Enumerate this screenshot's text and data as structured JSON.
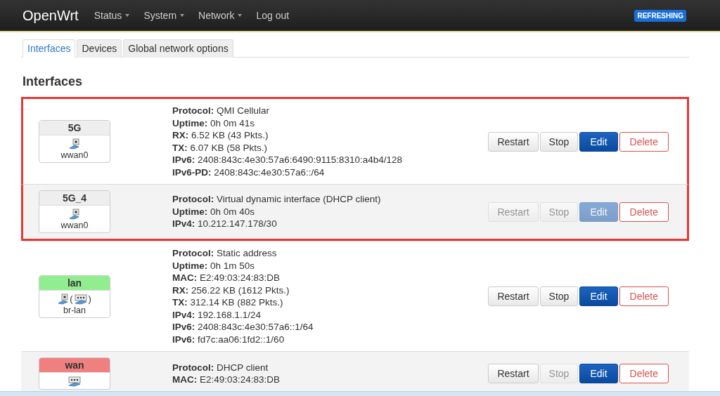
{
  "navbar": {
    "brand": "OpenWrt",
    "menus": [
      {
        "label": "Status",
        "dropdown": true
      },
      {
        "label": "System",
        "dropdown": true
      },
      {
        "label": "Network",
        "dropdown": true
      },
      {
        "label": "Log out",
        "dropdown": false
      }
    ],
    "badge": "REFRESHING"
  },
  "tabs": [
    {
      "label": "Interfaces",
      "selected": true
    },
    {
      "label": "Devices",
      "selected": false
    },
    {
      "label": "Global network options",
      "selected": false
    }
  ],
  "heading": "Interfaces",
  "interfaces": [
    {
      "name": "5G",
      "color": "#eeeeee",
      "highlighted": true,
      "icons": [
        {
          "kind": "port"
        }
      ],
      "device": "wwan0",
      "details": [
        "**Protocol:** QMI Cellular",
        "**Uptime:** 0h 0m 41s",
        "**RX:** 6.52 KB (43 Pkts.)",
        "**TX:** 6.07 KB (58 Pkts.)",
        "**IPv6:** 2408:843c:4e30:57a6:6490:9115:8310:a4b4/128",
        "**IPv6-PD:** 2408:843c:4e30:57a6::/64"
      ],
      "buttons": [
        {
          "label": "Restart",
          "kind": "default",
          "disabled": false
        },
        {
          "label": "Stop",
          "kind": "default",
          "disabled": false
        },
        {
          "label": "Edit",
          "kind": "primary",
          "disabled": false
        },
        {
          "label": "Delete",
          "kind": "danger",
          "disabled": false
        }
      ]
    },
    {
      "name": "5G_4",
      "color": "#eeeeee",
      "highlighted": true,
      "icons": [
        {
          "kind": "port"
        }
      ],
      "device": "wwan0",
      "details": [
        "**Protocol:** Virtual dynamic interface (DHCP client)",
        "**Uptime:** 0h 0m 40s",
        "**IPv4:** 10.212.147.178/30"
      ],
      "buttons": [
        {
          "label": "Restart",
          "kind": "default",
          "disabled": true
        },
        {
          "label": "Stop",
          "kind": "default",
          "disabled": true
        },
        {
          "label": "Edit",
          "kind": "primary",
          "disabled": true
        },
        {
          "label": "Delete",
          "kind": "danger",
          "disabled": false
        }
      ]
    },
    {
      "name": "lan",
      "color": "#90ee90",
      "highlighted": false,
      "icons": [
        {
          "kind": "port"
        },
        {
          "kind": "glyph",
          "text": "("
        },
        {
          "kind": "switch"
        },
        {
          "kind": "glyph",
          "text": ")"
        }
      ],
      "device": "br-lan",
      "details": [
        "**Protocol:** Static address",
        "**Uptime:** 0h 1m 50s",
        "**MAC:** E2:49:03:24:83:DB",
        "**RX:** 256.22 KB (1612 Pkts.)",
        "**TX:** 312.14 KB (882 Pkts.)",
        "**IPv4:** 192.168.1.1/24",
        "**IPv6:** 2408:843c:4e30:57a6::1/64",
        "**IPv6:** fd7c:aa06:1fd2::1/60"
      ],
      "buttons": [
        {
          "label": "Restart",
          "kind": "default",
          "disabled": false
        },
        {
          "label": "Stop",
          "kind": "default",
          "disabled": false
        },
        {
          "label": "Edit",
          "kind": "primary",
          "disabled": false
        },
        {
          "label": "Delete",
          "kind": "danger",
          "disabled": false
        }
      ]
    },
    {
      "name": "wan",
      "color": "#f08080",
      "highlighted": false,
      "icons": [
        {
          "kind": "switch"
        }
      ],
      "details": [
        "**Protocol:** DHCP client",
        "**MAC:** E2:49:03:24:83:DB"
      ],
      "buttons": [
        {
          "label": "Restart",
          "kind": "default",
          "disabled": false
        },
        {
          "label": "Stop",
          "kind": "default",
          "disabled": true
        },
        {
          "label": "Edit",
          "kind": "primary",
          "disabled": false
        },
        {
          "label": "Delete",
          "kind": "danger",
          "disabled": false
        }
      ]
    }
  ]
}
